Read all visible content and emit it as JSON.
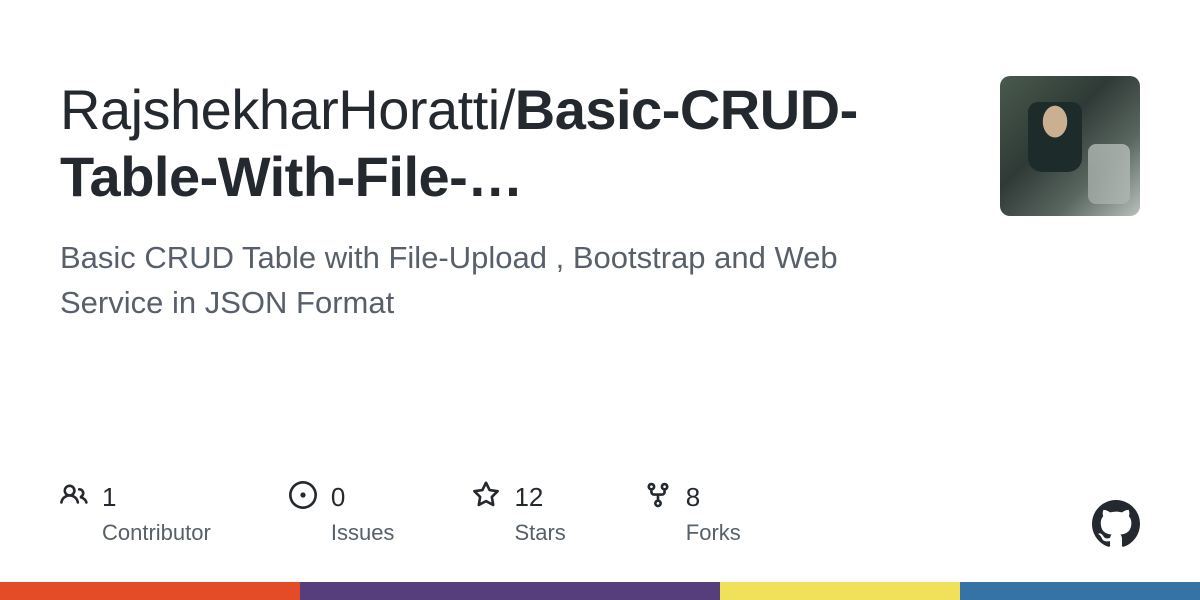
{
  "repo": {
    "owner": "RajshekharHoratti",
    "separator": "/",
    "name_display": "Basic-CRUD-Table-With-File-…",
    "description": "Basic CRUD Table with File-Upload , Bootstrap and Web Service in JSON Format"
  },
  "stats": {
    "contributors": {
      "value": "1",
      "label": "Contributor"
    },
    "issues": {
      "value": "0",
      "label": "Issues"
    },
    "stars": {
      "value": "12",
      "label": "Stars"
    },
    "forks": {
      "value": "8",
      "label": "Forks"
    }
  },
  "colors": {
    "stripe": [
      {
        "color": "#e34c26",
        "weight": 25
      },
      {
        "color": "#563d7c",
        "weight": 35
      },
      {
        "color": "#f1e05a",
        "weight": 20
      },
      {
        "color": "#3572A5",
        "weight": 20
      }
    ]
  }
}
